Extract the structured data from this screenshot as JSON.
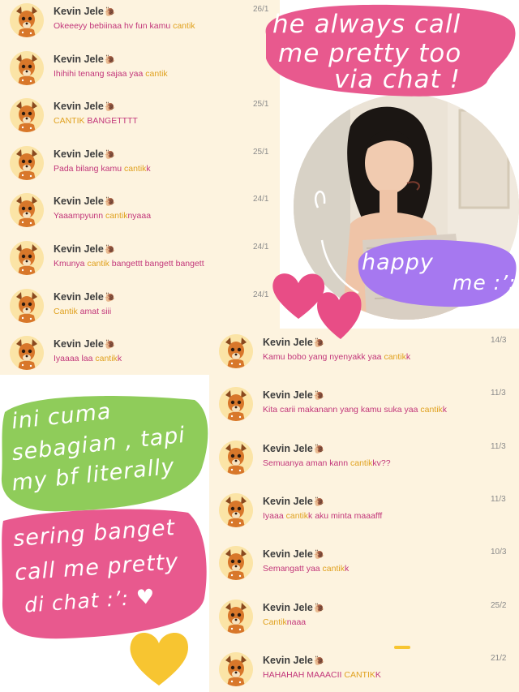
{
  "contact_name": "Kevin Jele",
  "contact_emoji": "🐌",
  "colors": {
    "message": "#c2367a",
    "highlight": "#e0a11f",
    "date": "#8a8a8a",
    "pink_blob": "#e8598e",
    "green_blob": "#8fcc5a",
    "purple_blob": "#a678f0",
    "yellow_heart": "#f7c531"
  },
  "left_chats": [
    {
      "date": "26/1",
      "pre": "Okeeeyy bebiinaa hv fun kamu ",
      "hl": "cantik",
      "post": ""
    },
    {
      "date": "",
      "pre": "Ihihihi tenang sajaa yaa ",
      "hl": "cantik",
      "post": ""
    },
    {
      "date": "25/1",
      "pre": "",
      "hl": "CANTIK",
      "post": " BANGETTTT"
    },
    {
      "date": "25/1",
      "pre": "Pada bilang kamu ",
      "hl": "cantik",
      "post": "k"
    },
    {
      "date": "24/1",
      "pre": "Yaaampyunn ",
      "hl": "cantik",
      "post": "nyaaa"
    },
    {
      "date": "24/1",
      "pre": "Kmunya ",
      "hl": "cantik",
      "post": " bangettt bangett bangett"
    },
    {
      "date": "24/1",
      "pre": "",
      "hl": "Cantik",
      "post": " amat siii"
    },
    {
      "date": "",
      "pre": "Iyaaaa laa ",
      "hl": "cantik",
      "post": "k"
    }
  ],
  "right_chats": [
    {
      "date": "14/3",
      "pre": "Kamu bobo yang nyenyakk yaa ",
      "hl": "cantik",
      "post": "k"
    },
    {
      "date": "11/3",
      "pre": "Kita carii makanann yang kamu suka yaa ",
      "hl": "cantik",
      "post": "k"
    },
    {
      "date": "11/3",
      "pre": "Semuanya aman kann ",
      "hl": "cantik",
      "post": "kv??"
    },
    {
      "date": "11/3",
      "pre": "Iyaaa ",
      "hl": "cantik",
      "post": "k aku minta maaafff"
    },
    {
      "date": "10/3",
      "pre": "Semangatt yaa ",
      "hl": "cantik",
      "post": "k"
    },
    {
      "date": "25/2",
      "pre": "",
      "hl": "Cantik",
      "post": "naaa"
    },
    {
      "date": "21/2",
      "pre": "HAHAHAH MAAACII ",
      "hl": "CANTIK",
      "post": "K"
    }
  ],
  "annotations": {
    "top_right": [
      "he always call",
      "me pretty too",
      "via chat !"
    ],
    "happy": [
      "happy",
      "me :’:"
    ],
    "green": [
      "ini cuma",
      "sebagian , tapi",
      "my bf literally"
    ],
    "pink_bottom": [
      "sering banget",
      "call me pretty",
      "di chat :’: ♥"
    ]
  }
}
